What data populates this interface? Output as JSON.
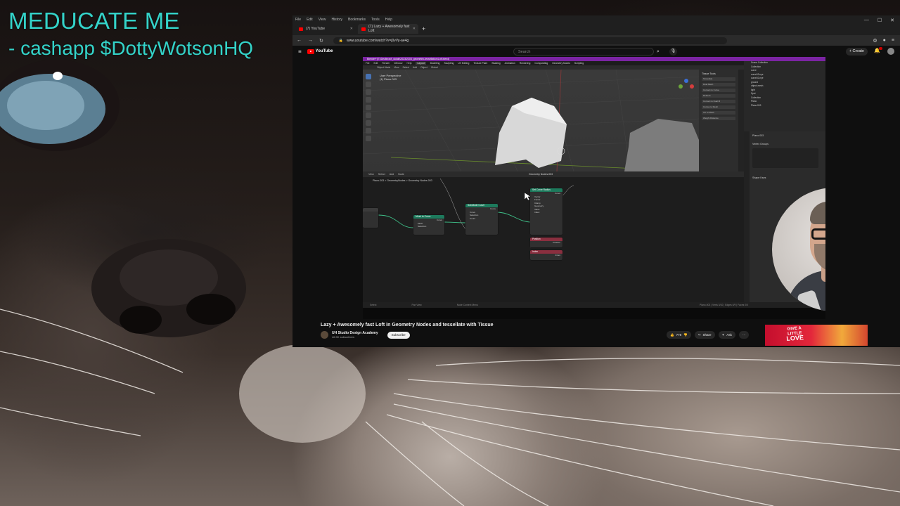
{
  "overlay": {
    "title": "MEDUCATE ME",
    "subtitle": "- cashapp $DottyWotsonHQ",
    "text_color": "#34d3c9"
  },
  "browser": {
    "menu": [
      "File",
      "Edit",
      "View",
      "History",
      "Bookmarks",
      "Tools",
      "Help"
    ],
    "tabs": [
      {
        "label": "(7) YouTube",
        "active": false
      },
      {
        "label": "(7) Lazy + Awesomely fast Loft",
        "active": true
      }
    ],
    "new_tab_icon": "+",
    "url": "www.youtube.com/watch?v=j0vVy-ae4g",
    "nav_icons": [
      "back-icon",
      "forward-icon",
      "reload-icon"
    ]
  },
  "youtube": {
    "logo_text": "YouTube",
    "search_placeholder": "Search",
    "create_label": "Create",
    "video": {
      "title": "Lazy + Awesomely fast Loft in Geometry Nodes and tessellate with Tissue",
      "channel": "UH Studio Design Academy",
      "subscribers": "46.9K subscribers",
      "subscribe_label": "Subscribe",
      "likes": "778",
      "share_label": "Share",
      "ask_label": "Ask",
      "more_label": "···"
    },
    "ad": {
      "line1": "GIVE A",
      "line2": "LITTLE",
      "line3": "LOVE"
    }
  },
  "blender": {
    "title_bar": "Blender* [E:\\Dezlinrad\\_ukiaki\\2023\\2203_geometric-tessellation\\Loft.blend]",
    "menu": [
      "File",
      "Edit",
      "Render",
      "Window",
      "Help"
    ],
    "workspaces": [
      "Layout",
      "Modeling",
      "Sculpting",
      "UV Editing",
      "Texture Paint",
      "Shading",
      "Animation",
      "Rendering",
      "Compositing",
      "Geometry Nodes",
      "Scripting"
    ],
    "active_workspace": "Layout",
    "viewport_header": [
      "Object Mode",
      "View",
      "Select",
      "Add",
      "Object",
      "Global"
    ],
    "viewport_label_1": "User Perspective",
    "viewport_label_2": "(1) Plano.003",
    "npanel_title": "Tissue Tools",
    "npanel_rows": [
      "Tessellate",
      "Dual Mesh",
      "Convert to Curve",
      "Refresh",
      "Convert to Dual M",
      "Curves to Mesh",
      "UV to Mesh",
      "Weight Distance"
    ],
    "outliner": [
      "Scene Collection",
      "Collection",
      "curve",
      "curve03-nye",
      "curve02-nye",
      "ground",
      "object-mesh",
      "light",
      "Spot",
      "Collection",
      "Plano",
      "Plano.003"
    ],
    "props_header": "Plano.003",
    "props_section": "Vertex Groups",
    "props_section2": "Shape Keys",
    "node_header": [
      "View",
      "Select",
      "Add",
      "Node"
    ],
    "node_tree_name": "Geometry Nodes.003",
    "breadcrumb": "Plano.003  >  GeometryNodes  >  Geometry Nodes.003",
    "nodes": [
      {
        "title": "Mesh to Curve",
        "rows": [
          "Curve",
          "Mesh",
          "Selection"
        ],
        "color": "#1d7a5c"
      },
      {
        "title": "Subdivide Curve",
        "rows": [
          "Curve",
          "Curve",
          "Selection",
          "Count"
        ],
        "color": "#1d7a5c"
      },
      {
        "title": "Set Curve Radius",
        "rows": [
          "Curve",
          "Vector",
          "Factor",
          "Clamp",
          "Geometry",
          "Value",
          "Index"
        ],
        "color": "#1d7a5c"
      },
      {
        "title": "Position",
        "rows": [
          "Position"
        ],
        "color": "#8a2f3f"
      },
      {
        "title": "Index",
        "rows": [
          "Index"
        ],
        "color": "#8a2f3f"
      }
    ],
    "status_items": [
      "Select",
      "Pan View",
      "Node Context Menu",
      "Plano.003 | Verts 0/10 | Edges 0/9 | Faces 0/0"
    ]
  }
}
